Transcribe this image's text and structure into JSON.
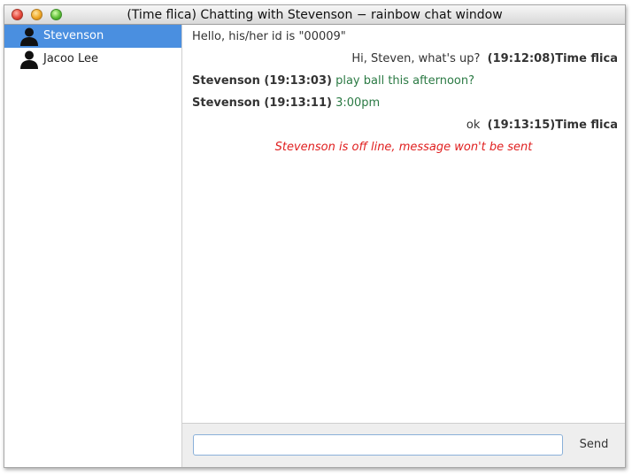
{
  "window": {
    "title": "(Time flica) Chatting with Stevenson − rainbow chat window"
  },
  "contacts": [
    {
      "name": "Stevenson",
      "selected": true,
      "icon": "user-silhouette-icon"
    },
    {
      "name": "Jacoo Lee",
      "selected": false,
      "icon": "user-silhouette-icon"
    }
  ],
  "messages": [
    {
      "kind": "system",
      "text": "Hello, his/her id is \"00009\""
    },
    {
      "kind": "outgoing",
      "text": "Hi, Steven, what's up?",
      "meta": "(19:12:08)Time flica"
    },
    {
      "kind": "incoming",
      "meta": "Stevenson (19:13:03)",
      "text": "play ball this afternoon?"
    },
    {
      "kind": "incoming",
      "meta": "Stevenson (19:13:11)",
      "text": "3:00pm"
    },
    {
      "kind": "outgoing",
      "text": "ok",
      "meta": "(19:13:15)Time flica"
    },
    {
      "kind": "notice",
      "text": "Stevenson is off line, message won't be sent"
    }
  ],
  "composer": {
    "input_value": "",
    "send_label": "Send"
  },
  "colors": {
    "selection": "#4a8fe0",
    "incoming_text": "#2b7a44",
    "notice": "#e02020"
  }
}
